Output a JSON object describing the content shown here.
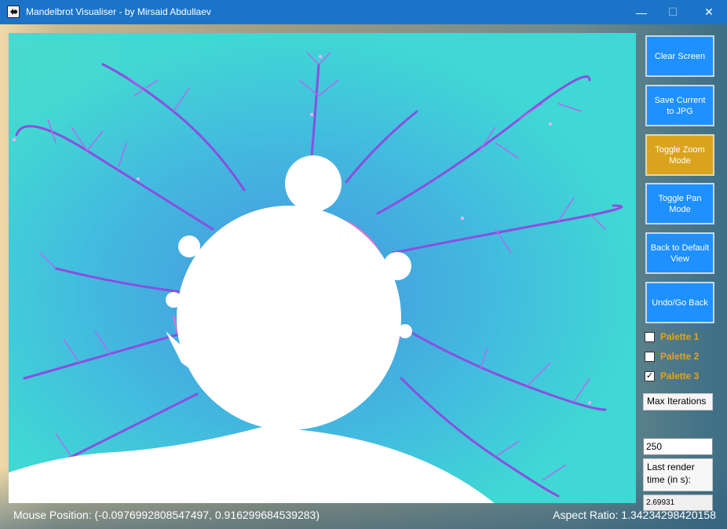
{
  "window": {
    "title": "Mandelbrot Visualiser - by Mirsaid Abdullaev",
    "minimize_glyph": "—",
    "maximize_glyph": "☐",
    "close_glyph": "✕"
  },
  "sidebar": {
    "buttons": [
      {
        "label": "Clear Screen",
        "active": false
      },
      {
        "label": "Save Current to JPG",
        "active": false
      },
      {
        "label": "Toggle Zoom Mode",
        "active": true
      },
      {
        "label": "Toggle Pan Mode",
        "active": false
      },
      {
        "label": "Back to Default View",
        "active": false
      },
      {
        "label": "Undo/Go Back",
        "active": false
      }
    ],
    "palettes": [
      {
        "label": "Palette 1",
        "checked": false
      },
      {
        "label": "Palette 2",
        "checked": false
      },
      {
        "label": "Palette 3",
        "checked": true
      }
    ],
    "max_iterations_label": "Max Iterations",
    "max_iterations_value": "250",
    "render_time_label": "Last render time (in s):",
    "render_time_value": "2.69931"
  },
  "status": {
    "mouse_position": "Mouse Position: (-0.0976992808547497, 0.916299684539283)",
    "aspect_ratio": "Aspect Ratio: 1.34234298420158"
  },
  "colors": {
    "button_blue": "#1e90ff",
    "button_active": "#d9a31e",
    "palette_label": "#e6a21e",
    "fractal_background": "#3fd8d4",
    "fractal_edge": "#8a4fe0",
    "fractal_highlight": "#f070d0"
  }
}
